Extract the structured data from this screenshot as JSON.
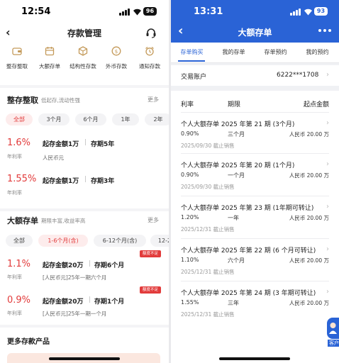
{
  "left": {
    "status": {
      "time": "12:54",
      "battery": "96"
    },
    "nav": {
      "title": "存款管理"
    },
    "quick_actions": [
      {
        "label": "整存整取",
        "icon": "wallet-card-icon"
      },
      {
        "label": "大额存单",
        "icon": "calendar-icon"
      },
      {
        "label": "结构性存款",
        "icon": "cube-icon"
      },
      {
        "label": "外币存款",
        "icon": "coin-icon"
      },
      {
        "label": "通知存款",
        "icon": "alarm-clock-icon"
      }
    ],
    "fixed": {
      "title": "整存整取",
      "subtitle": "低起存,流动性强",
      "more": "更多",
      "filters": [
        "全部",
        "3个月",
        "6个月",
        "1年",
        "2年"
      ],
      "products": [
        {
          "rate": "1.6%",
          "rate_label": "年利率",
          "min": "起存金额1万",
          "term": "存期5年",
          "sub": "人民币元"
        },
        {
          "rate": "1.55%",
          "rate_label": "年利率",
          "min": "起存金额1万",
          "term": "存期3年",
          "sub": "人民币元"
        }
      ]
    },
    "large": {
      "title": "大额存单",
      "subtitle": "期限丰富,收益率高",
      "more": "更多",
      "filters": [
        "全部",
        "1-6个月(含)",
        "6-12个月(含)",
        "12-2"
      ],
      "products": [
        {
          "rate": "1.1%",
          "rate_label": "年利率",
          "min": "起存金额20万",
          "term": "存期6个月",
          "sub": "[人民币元]25年一期六个月",
          "badge": "额度不足"
        },
        {
          "rate": "0.9%",
          "rate_label": "年利率",
          "min": "起存金额20万",
          "term": "存期1个月",
          "sub": "[人民币元]25年一期一个月",
          "badge": "额度不足"
        }
      ]
    },
    "more_products": {
      "title": "更多存款产品"
    }
  },
  "right": {
    "status": {
      "time": "13:31",
      "battery": "93"
    },
    "nav": {
      "title": "大额存单"
    },
    "tabs": [
      "存单购买",
      "我的存单",
      "存单预约",
      "我的预约"
    ],
    "account": {
      "label": "交易账户",
      "value": "6222***1708"
    },
    "columns": {
      "rate": "利率",
      "term": "期限",
      "min": "起点金额"
    },
    "items": [
      {
        "title": "个人大额存单 2025 年第 21 期 (3个月)",
        "rate": "0.90%",
        "term": "三个月",
        "min": "人民币 20.00 万",
        "deadline": "2025/09/30 截止销售"
      },
      {
        "title": "个人大额存单 2025 年第 20 期 (1个月)",
        "rate": "0.90%",
        "term": "一个月",
        "min": "人民币 20.00 万",
        "deadline": "2025/09/30 截止销售"
      },
      {
        "title": "个人大额存单 2025 年第 23 期 (1年期可转让)",
        "rate": "1.20%",
        "term": "一年",
        "min": "人民币 20.00 万",
        "deadline": "2025/12/31 截止销售"
      },
      {
        "title": "个人大额存单 2025 年第 22 期 (6 个月可转让)",
        "rate": "1.10%",
        "term": "六个月",
        "min": "人民币 20.00 万",
        "deadline": "2025/12/31 截止销售"
      },
      {
        "title": "个人大额存单 2025 年第 24 期 (3 年期可转让)",
        "rate": "1.55%",
        "term": "三年",
        "min": "人民币 20.00 万",
        "deadline": "2025/12/31 截止销售"
      }
    ],
    "float_label": "客户"
  },
  "colors": {
    "accent_red": "#e23b3b",
    "accent_blue": "#2a63d6"
  }
}
